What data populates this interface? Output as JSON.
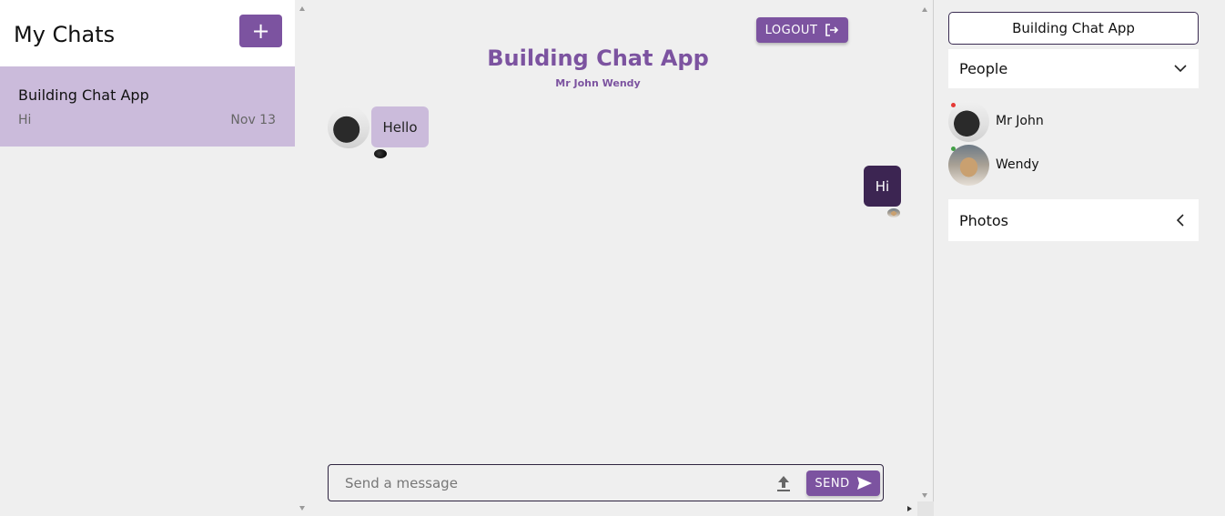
{
  "left": {
    "title": "My Chats",
    "new_chat_label": "+",
    "chats": [
      {
        "name": "Building Chat App",
        "last_message": "Hi",
        "date": "Nov 13"
      }
    ]
  },
  "header": {
    "logout_label": "LOGOUT",
    "chat_title": "Building Chat App",
    "members_line": "Mr John Wendy"
  },
  "messages": [
    {
      "text": "Hello",
      "from": "other",
      "sender": "Mr John"
    },
    {
      "text": "Hi",
      "from": "self",
      "sender": "Wendy"
    }
  ],
  "composer": {
    "placeholder": "Send a message",
    "send_label": "SEND"
  },
  "sidebar": {
    "group_name": "Building Chat App",
    "people_label": "People",
    "people": [
      {
        "name": "Mr John",
        "status_color": "#e53935"
      },
      {
        "name": "Wendy",
        "status_color": "#43a047"
      }
    ],
    "photos_label": "Photos"
  },
  "colors": {
    "accent": "#7c53a0",
    "selected_chat": "#cbbbdb",
    "own_bubble": "#3c2552"
  }
}
